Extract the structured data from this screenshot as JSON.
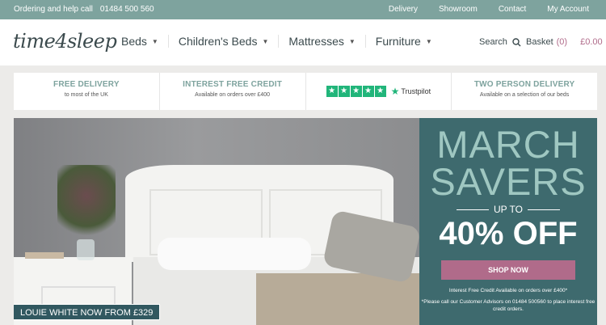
{
  "topbar": {
    "help_label": "Ordering and help call",
    "phone": "01484 500 560",
    "links": [
      "Delivery",
      "Showroom",
      "Contact",
      "My Account"
    ]
  },
  "header": {
    "logo": "time4sleep",
    "nav": [
      "Beds",
      "Children's Beds",
      "Mattresses",
      "Furniture"
    ],
    "search_label": "Search",
    "basket_label": "Basket",
    "basket_count": "(0)",
    "basket_total": "£0.00"
  },
  "benefits": [
    {
      "title": "FREE DELIVERY",
      "subtitle": "to most of the UK"
    },
    {
      "title": "INTEREST FREE CREDIT",
      "subtitle": "Available on orders over £400"
    },
    {
      "title": "TWO PERSON DELIVERY",
      "subtitle": "Available on a selection of our beds"
    }
  ],
  "trustpilot": {
    "label": "Trustpilot",
    "stars": 5
  },
  "hero": {
    "caption": "LOUIE WHITE NOW FROM £329",
    "promo_line1": "MARCH",
    "promo_line2": "SAVERS",
    "up_to": "UP TO",
    "discount": "40% OFF",
    "cta": "SHOP NOW",
    "note1": "Interest Free Credit Available on orders over £400*",
    "note2": "*Please call our Customer Advisors on 01484 500560 to place interest free credit orders."
  },
  "colors": {
    "accent": "#7ea39e",
    "promo_bg": "#3e6a6e",
    "cta": "#b06b8a"
  }
}
